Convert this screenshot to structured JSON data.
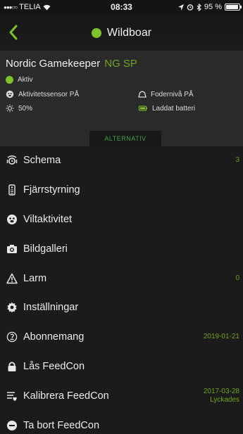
{
  "status": {
    "carrier": "TELIA",
    "time": "08:33",
    "battery": "95 %",
    "battery_level": 0.95
  },
  "nav": {
    "title": "Wildboar"
  },
  "device": {
    "name": "Nordic Gamekeeper",
    "code": "NG SP",
    "status": "Aktiv",
    "activity_sensor": "Aktivitetssensor PÅ",
    "feed_level": "Fodernivå PÅ",
    "brightness": "50%",
    "battery_status": "Laddat batteri"
  },
  "tab": {
    "label": "ALTERNATIV"
  },
  "menu": {
    "items": [
      {
        "label": "Schema",
        "value": "3",
        "icon": "schedule-icon"
      },
      {
        "label": "Fjärrstyrning",
        "value": "",
        "icon": "remote-icon"
      },
      {
        "label": "Viltaktivitet",
        "value": "",
        "icon": "boar-icon"
      },
      {
        "label": "Bildgalleri",
        "value": "",
        "icon": "camera-icon"
      },
      {
        "label": "Larm",
        "value": "0",
        "icon": "warning-icon"
      },
      {
        "label": "Inställningar",
        "value": "",
        "icon": "gear-icon"
      },
      {
        "label": "Abonnemang",
        "value": "2019-01-21",
        "icon": "subscription-icon"
      },
      {
        "label": "Lås FeedCon",
        "value": "",
        "icon": "lock-icon"
      },
      {
        "label": "Kalibrera FeedCon",
        "value": "2017-03-28",
        "value2": "Lyckades",
        "icon": "calibrate-icon"
      },
      {
        "label": "Ta bort FeedCon",
        "value": "",
        "icon": "remove-icon"
      }
    ]
  },
  "colors": {
    "accent_green": "#7ec22a",
    "value_green": "#6fa51f",
    "tab_green": "#3ea24a"
  }
}
